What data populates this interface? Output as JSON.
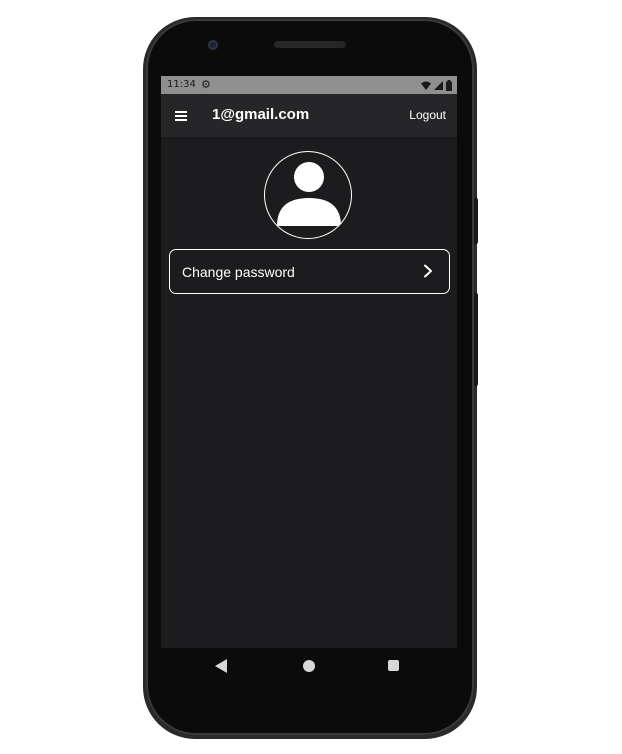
{
  "status_bar": {
    "time": "11:34",
    "settings_icon": "gear-icon",
    "wifi_icon": "wifi-icon",
    "signal_icon": "signal-icon",
    "battery_icon": "battery-icon"
  },
  "app_bar": {
    "menu_icon": "hamburger-menu-icon",
    "title": "1@gmail.com",
    "logout_label": "Logout"
  },
  "profile": {
    "avatar_icon": "person-avatar-icon"
  },
  "settings_list": {
    "items": [
      {
        "label": "Change password",
        "icon": "chevron-right-icon"
      }
    ]
  },
  "nav_bar": {
    "back_icon": "back-triangle-icon",
    "home_icon": "home-circle-icon",
    "recents_icon": "recents-square-icon"
  },
  "colors": {
    "screen_bg": "#1c1c1e",
    "app_bar_bg": "#262628",
    "status_bar_bg": "#8f8f8f",
    "foreground": "#ffffff",
    "device_frame": "#0b0b0b"
  }
}
